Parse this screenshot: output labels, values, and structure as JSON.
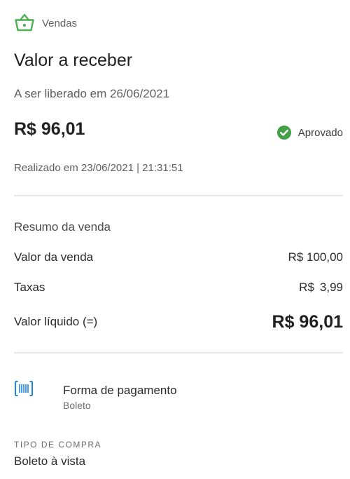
{
  "header": {
    "section_label": "Vendas",
    "icon": "shopping-basket-icon"
  },
  "title": "Valor a receber",
  "release_text": "A ser liberado em 26/06/2021",
  "amount": "R$ 96,01",
  "status": {
    "label": "Aprovado",
    "icon": "check-circle-icon",
    "color": "#43a047"
  },
  "realized_text": "Realizado em 23/06/2021 | 21:31:51",
  "summary": {
    "title": "Resumo da venda",
    "rows": [
      {
        "label": "Valor da venda",
        "value": "R$ 100,00"
      },
      {
        "label": "Taxas",
        "currency": "R$",
        "amount": "3,99"
      },
      {
        "label": "Valor líquido (=)",
        "value": "R$ 96,01"
      }
    ]
  },
  "payment": {
    "title": "Forma de pagamento",
    "subtitle": "Boleto",
    "icon": "barcode-icon",
    "icon_color": "#1e88e5"
  },
  "purchase_type": {
    "label": "TIPO DE COMPRA",
    "value": "Boleto à vista"
  },
  "colors": {
    "brand_green": "#4caf50",
    "approved_green": "#43a047",
    "accent_blue": "#1e88e5"
  }
}
